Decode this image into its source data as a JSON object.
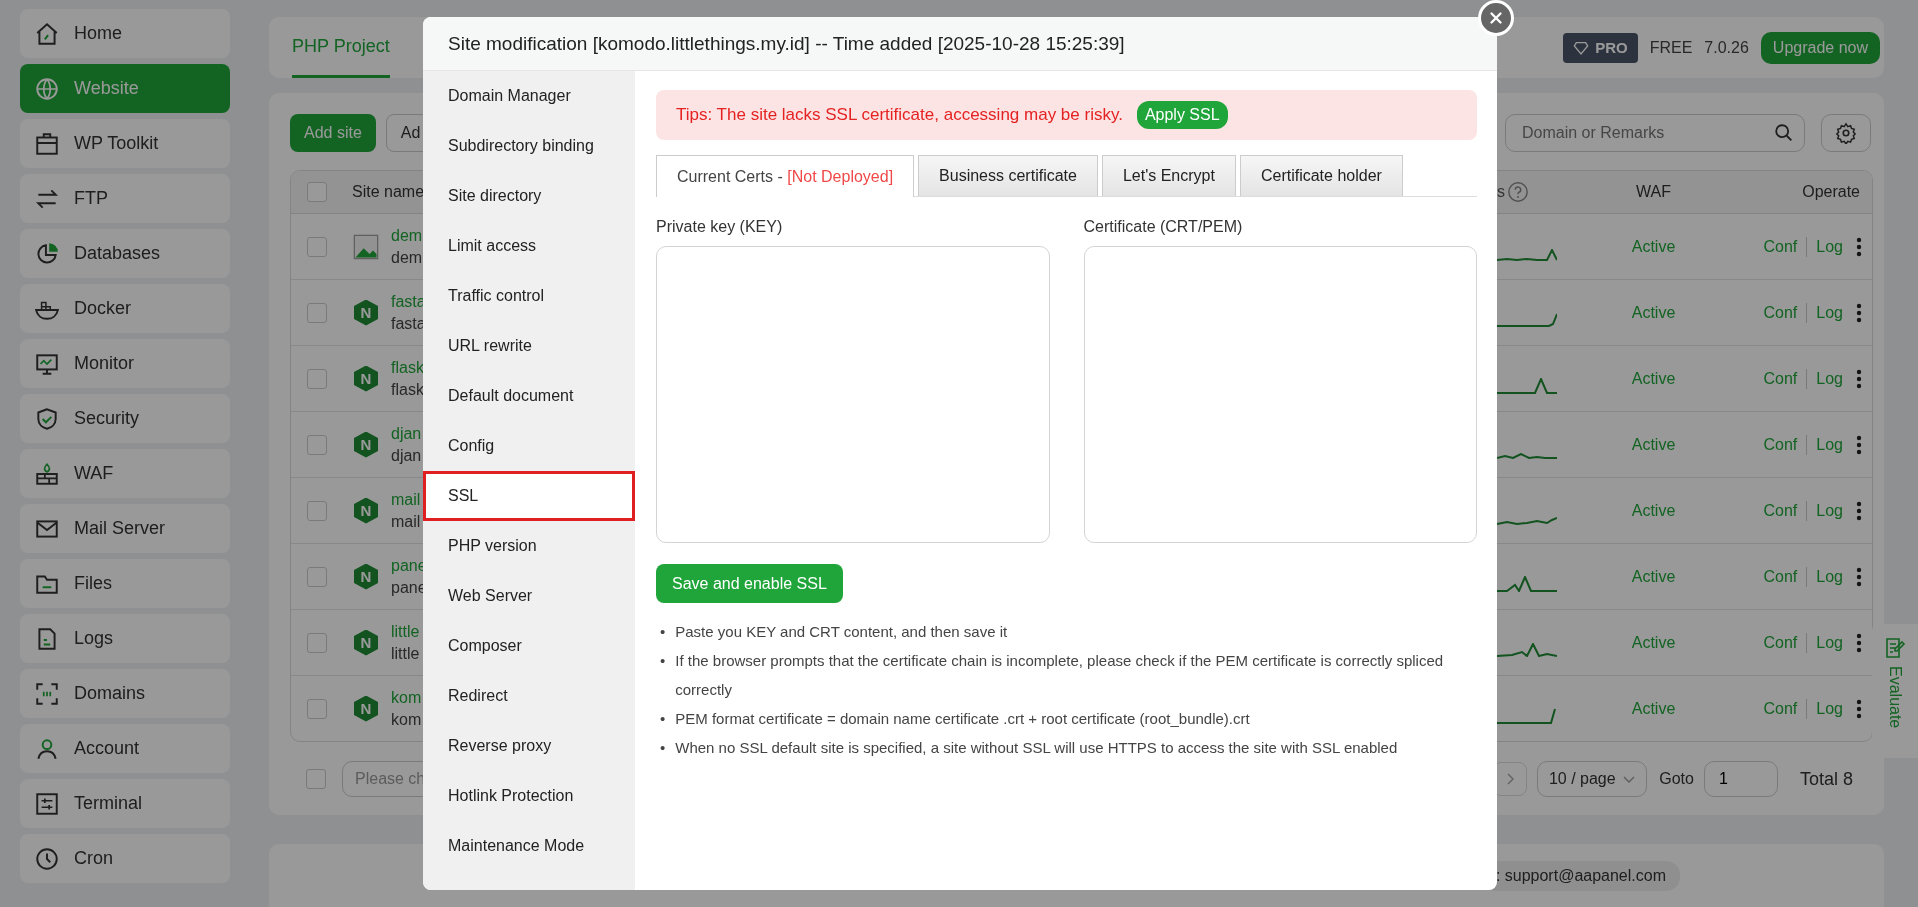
{
  "sidebar": {
    "items": [
      {
        "label": "Home",
        "selected": false
      },
      {
        "label": "Website",
        "selected": true
      },
      {
        "label": "WP Toolkit",
        "selected": false
      },
      {
        "label": "FTP",
        "selected": false
      },
      {
        "label": "Databases",
        "selected": false
      },
      {
        "label": "Docker",
        "selected": false
      },
      {
        "label": "Monitor",
        "selected": false
      },
      {
        "label": "Security",
        "selected": false
      },
      {
        "label": "WAF",
        "selected": false
      },
      {
        "label": "Mail Server",
        "selected": false
      },
      {
        "label": "Files",
        "selected": false
      },
      {
        "label": "Logs",
        "selected": false
      },
      {
        "label": "Domains",
        "selected": false
      },
      {
        "label": "Account",
        "selected": false
      },
      {
        "label": "Terminal",
        "selected": false
      },
      {
        "label": "Cron",
        "selected": false
      }
    ]
  },
  "page_tabs": [
    {
      "label": "PHP Project",
      "selected": true
    }
  ],
  "version_bar": {
    "badge": "PRO",
    "edition": "FREE",
    "version": "7.0.26",
    "upgrade_button": "Upgrade now"
  },
  "toolbar": {
    "buttons": [
      "Add site",
      "Ad"
    ],
    "search": {
      "placeholder": "Domain or Remarks"
    }
  },
  "table": {
    "select_all_checked": false,
    "columns": [
      "Site name",
      "s",
      "WAF",
      "Operate"
    ],
    "rows": [
      {
        "kind": "image",
        "checked": false,
        "name": "dem",
        "subtitle": "dem",
        "waf": "Active",
        "actions": [
          "Conf",
          "Log"
        ]
      },
      {
        "kind": "nginx",
        "badge": "N",
        "checked": false,
        "name": "fasta",
        "subtitle": "fasta",
        "waf": "Active",
        "actions": [
          "Conf",
          "Log"
        ]
      },
      {
        "kind": "nginx",
        "badge": "N",
        "checked": false,
        "name": "flask",
        "subtitle": "flask",
        "waf": "Active",
        "actions": [
          "Conf",
          "Log"
        ]
      },
      {
        "kind": "nginx",
        "badge": "N",
        "checked": false,
        "name": "djan",
        "subtitle": "djan",
        "waf": "Active",
        "actions": [
          "Conf",
          "Log"
        ]
      },
      {
        "kind": "nginx",
        "badge": "N",
        "checked": false,
        "name": "mail",
        "subtitle": "mail",
        "waf": "Active",
        "actions": [
          "Conf",
          "Log"
        ]
      },
      {
        "kind": "nginx",
        "badge": "N",
        "checked": false,
        "name": "pane",
        "subtitle": "pane",
        "waf": "Active",
        "actions": [
          "Conf",
          "Log"
        ]
      },
      {
        "kind": "nginx",
        "badge": "N",
        "checked": false,
        "name": "little",
        "subtitle": "little",
        "waf": "Active",
        "actions": [
          "Conf",
          "Log"
        ]
      },
      {
        "kind": "nginx",
        "badge": "N",
        "checked": false,
        "name": "kom",
        "subtitle": "kom",
        "waf": "Active",
        "actions": [
          "Conf",
          "Log"
        ]
      }
    ]
  },
  "pagination": {
    "batch_checked": false,
    "batch_placeholder": "Please ch",
    "page_size": "10 / page",
    "goto_label": "Goto",
    "goto_value": "1",
    "total": "Total 8"
  },
  "footer": {
    "contact": ": support@aapanel.com"
  },
  "evaluate_tab": {
    "label": "Evaluate"
  },
  "modal": {
    "title": "Site modification [komodo.littlethings.my.id] -- Time added [2025-10-28 15:25:39]",
    "menu": [
      {
        "label": "Domain Manager",
        "selected": false
      },
      {
        "label": "Subdirectory binding",
        "selected": false
      },
      {
        "label": "Site directory",
        "selected": false
      },
      {
        "label": "Limit access",
        "selected": false
      },
      {
        "label": "Traffic control",
        "selected": false
      },
      {
        "label": "URL rewrite",
        "selected": false
      },
      {
        "label": "Default document",
        "selected": false
      },
      {
        "label": "Config",
        "selected": false
      },
      {
        "label": "SSL",
        "selected": true
      },
      {
        "label": "PHP version",
        "selected": false
      },
      {
        "label": "Web Server",
        "selected": false
      },
      {
        "label": "Composer",
        "selected": false
      },
      {
        "label": "Redirect",
        "selected": false
      },
      {
        "label": "Reverse proxy",
        "selected": false
      },
      {
        "label": "Hotlink Protection",
        "selected": false
      },
      {
        "label": "Maintenance Mode",
        "selected": false
      }
    ],
    "tip": {
      "text": "Tips: The site lacks SSL certificate, accessing may be risky.",
      "button": "Apply SSL"
    },
    "tabs": [
      {
        "label": "Current Certs - ",
        "status": "[Not Deployed]",
        "selected": true
      },
      {
        "label": "Business certificate",
        "selected": false
      },
      {
        "label": "Let's Encrypt",
        "selected": false
      },
      {
        "label": "Certificate holder",
        "selected": false
      }
    ],
    "fields": [
      {
        "label": "Private key (KEY)"
      },
      {
        "label": "Certificate (CRT/PEM)"
      }
    ],
    "save_button": "Save and enable SSL",
    "bullet": "•",
    "notes": [
      "Paste you KEY and CRT content, and then save it",
      "If the browser prompts that the certificate chain is incomplete, please check if the PEM certificate is correctly spliced correctly",
      "PEM format certificate = domain name certificate .crt + root certificate (root_bundle).crt",
      "When no SSL default site is specified, a site without SSL will use HTTPS to access the site with SSL enabled"
    ]
  }
}
